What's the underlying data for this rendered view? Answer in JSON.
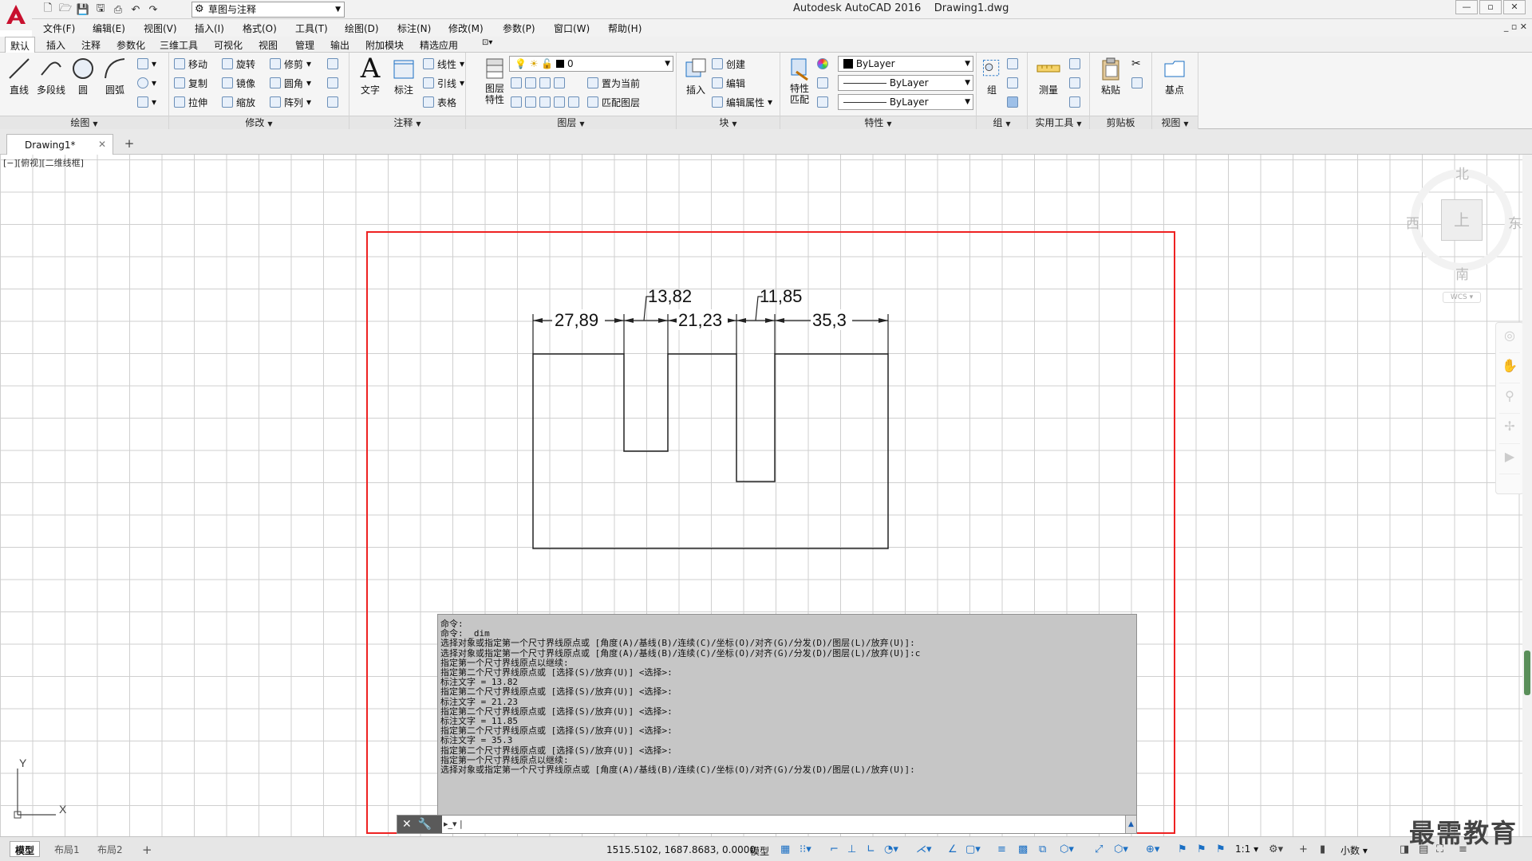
{
  "window": {
    "title": "Autodesk AutoCAD 2016    Drawing1.dwg",
    "controls": [
      "—",
      "▫",
      "✕"
    ]
  },
  "workspace": {
    "selected": "草图与注释"
  },
  "menu": [
    "文件(F)",
    "编辑(E)",
    "视图(V)",
    "插入(I)",
    "格式(O)",
    "工具(T)",
    "绘图(D)",
    "标注(N)",
    "修改(M)",
    "参数(P)",
    "窗口(W)",
    "帮助(H)"
  ],
  "ribbon_tabs": [
    "默认",
    "插入",
    "注释",
    "参数化",
    "三维工具",
    "可视化",
    "视图",
    "管理",
    "输出",
    "附加模块",
    "精选应用"
  ],
  "ribbon": {
    "draw": {
      "title": "绘图",
      "line": "直线",
      "polyline": "多段线",
      "circle": "圆",
      "arc": "圆弧"
    },
    "modify": {
      "title": "修改",
      "move": "移动",
      "rotate": "旋转",
      "trim": "修剪",
      "copy": "复制",
      "mirror": "镜像",
      "fillet": "圆角",
      "stretch": "拉伸",
      "scale": "缩放",
      "array": "阵列"
    },
    "annotation": {
      "title": "注释",
      "text": "文字",
      "dimension": "标注",
      "linear": "线性",
      "leader": "引线",
      "table": "表格"
    },
    "layers": {
      "title": "图层",
      "layer_props": "图层\n特性",
      "current_layer": "0",
      "set_current": "置为当前",
      "match_layer": "匹配图层"
    },
    "block": {
      "title": "块",
      "insert": "插入",
      "create": "创建",
      "edit": "编辑",
      "edit_attr": "编辑属性"
    },
    "properties": {
      "title": "特性",
      "match": "特性\n匹配",
      "color": "ByLayer",
      "linetype": "ByLayer",
      "lineweight": "ByLayer"
    },
    "groups": {
      "title": "组",
      "group": "组"
    },
    "utilities": {
      "title": "实用工具",
      "measure": "测量"
    },
    "clipboard": {
      "title": "剪贴板",
      "paste": "粘贴"
    },
    "view": {
      "title": "视图",
      "base": "基点"
    }
  },
  "doc_tab": {
    "name": "Drawing1*"
  },
  "viewport_label": "[−][俯视][二维线框]",
  "viewcube": {
    "north": "北",
    "south": "南",
    "east": "东",
    "west": "西",
    "top": "上",
    "wcs": "WCS"
  },
  "dimensions": [
    "27,89",
    "13,82",
    "21,23",
    "11,85",
    "35,3"
  ],
  "ucs": {
    "y": "Y",
    "x": "X"
  },
  "command_log": [
    "命令:",
    "命令: _dim",
    "选择对象或指定第一个尺寸界线原点或 [角度(A)/基线(B)/连续(C)/坐标(O)/对齐(G)/分发(D)/图层(L)/放弃(U)]:",
    "选择对象或指定第一个尺寸界线原点或 [角度(A)/基线(B)/连续(C)/坐标(O)/对齐(G)/分发(D)/图层(L)/放弃(U)]:c",
    "指定第一个尺寸界线原点以继续:",
    "指定第二个尺寸界线原点或 [选择(S)/放弃(U)] <选择>:",
    "标注文字 = 13.82",
    "指定第二个尺寸界线原点或 [选择(S)/放弃(U)] <选择>:",
    "标注文字 = 21.23",
    "指定第二个尺寸界线原点或 [选择(S)/放弃(U)] <选择>:",
    "标注文字 = 11.85",
    "指定第二个尺寸界线原点或 [选择(S)/放弃(U)] <选择>:",
    "标注文字 = 35.3",
    "指定第二个尺寸界线原点或 [选择(S)/放弃(U)] <选择>:",
    "指定第一个尺寸界线原点以继续:",
    "选择对象或指定第一个尺寸界线原点或 [角度(A)/基线(B)/连续(C)/坐标(O)/对齐(G)/分发(D)/图层(L)/放弃(U)]:"
  ],
  "layout_tabs": [
    "模型",
    "布局1",
    "布局2"
  ],
  "status": {
    "coords": "1515.5102, 1687.8683, 0.0000",
    "model": "模型",
    "scale": "1:1",
    "units": "小数"
  },
  "watermark": "最需教育",
  "colors": {
    "frame": "#e22222",
    "accent": "#1a6fc4",
    "logo": "#c8102e"
  }
}
